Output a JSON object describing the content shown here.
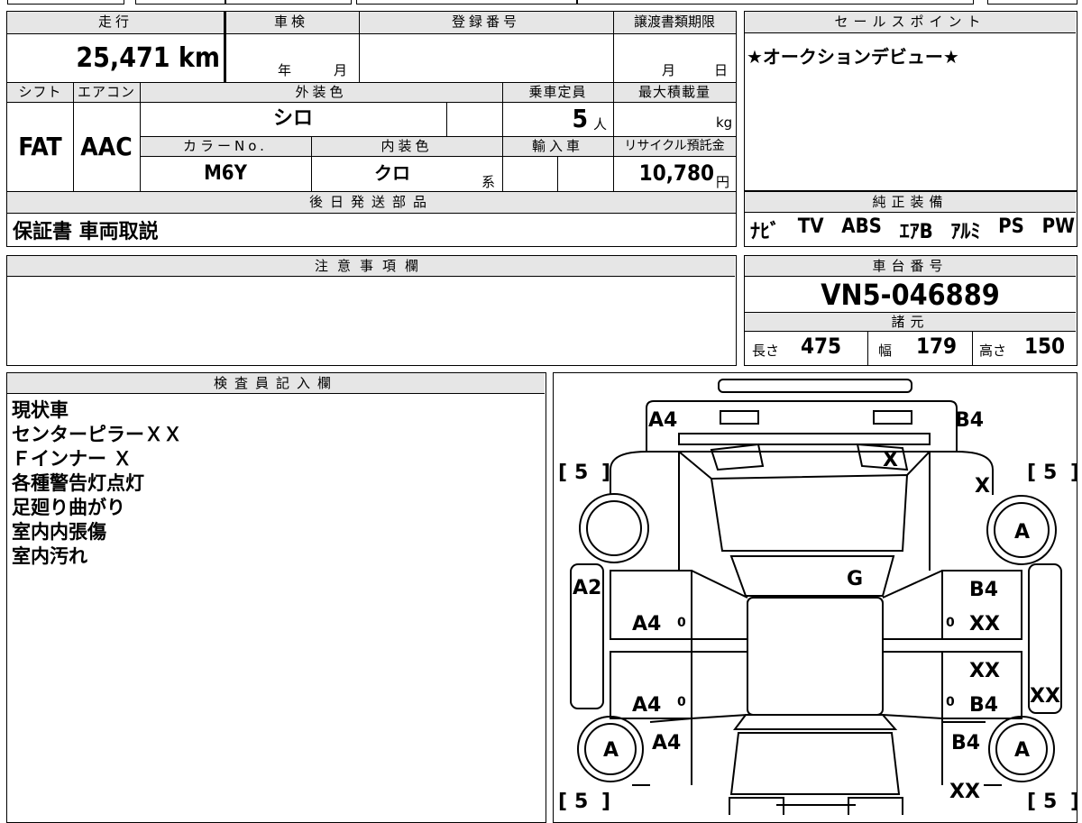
{
  "mileage": {
    "label": "走行",
    "value": "25,471",
    "unit": "km"
  },
  "shaken": {
    "label": "車検",
    "year_unit": "年",
    "month_unit": "月"
  },
  "registration": {
    "label": "登録番号"
  },
  "transfer_deadline": {
    "label": "譲渡書類期限",
    "month_unit": "月",
    "day_unit": "日"
  },
  "shift": {
    "label": "シフト",
    "value": "FAT"
  },
  "aircon": {
    "label": "エアコン",
    "value": "AAC"
  },
  "exterior_color": {
    "label": "外装色",
    "value": "シロ"
  },
  "capacity": {
    "label": "乗車定員",
    "value": "5",
    "unit": "人"
  },
  "max_load": {
    "label": "最大積載量",
    "unit": "kg"
  },
  "color_no": {
    "label": "カラーNo.",
    "value": "M6Y"
  },
  "interior_color": {
    "label": "内装色",
    "value": "クロ",
    "suffix": "系"
  },
  "import": {
    "label": "輸入車"
  },
  "recycle": {
    "label": "リサイクル預託金",
    "value": "10,780",
    "unit": "円"
  },
  "later_parts": {
    "label": "後日発送部品",
    "value": "保証書 車両取説"
  },
  "sales_point": {
    "label": "セールスポイント",
    "value": "★オークションデビュー★"
  },
  "equipment": {
    "label": "純正装備",
    "items": [
      "ﾅﾋﾞ",
      "TV",
      "ABS",
      "ｴｱB",
      "ｱﾙﾐ",
      "PS",
      "PW"
    ]
  },
  "notes": {
    "label": "注意事項欄"
  },
  "chassis": {
    "label": "車台番号",
    "value": "VN5-046889"
  },
  "specs": {
    "label": "諸元",
    "length_label": "長さ",
    "length": "475",
    "width_label": "幅",
    "width": "179",
    "height_label": "高さ",
    "height": "150"
  },
  "inspector": {
    "label": "検査員記入欄",
    "lines": [
      "現状車",
      "センターピラーＸＸ",
      "Ｆインナー Ｘ",
      "各種警告灯点灯",
      "足廻り曲がり",
      "室内内張傷",
      "室内汚れ"
    ]
  },
  "diagram": {
    "front_left": "A4",
    "front_right": "B4",
    "windshield": "X",
    "right_fender": "X",
    "roof": "G",
    "left_sill": "A2",
    "left_front_door": "A4",
    "left_rear_door": "A4",
    "left_rear_fender": "A4",
    "right_front_door_a": "B4",
    "right_front_door_b": "XX",
    "right_rear_door_a": "XX",
    "right_rear_door_b": "B4",
    "right_sill": "XX",
    "right_rear_fender": "B4",
    "rear_bumper": "XX",
    "tire_fl": "5",
    "tire_fr": "5",
    "tire_rl": "5",
    "tire_rr": "5",
    "wheel_fr": "A",
    "wheel_rl": "A",
    "wheel_rr": "A",
    "door_zero_1": "0",
    "door_zero_2": "0",
    "door_zero_3": "0",
    "door_zero_4": "0"
  }
}
